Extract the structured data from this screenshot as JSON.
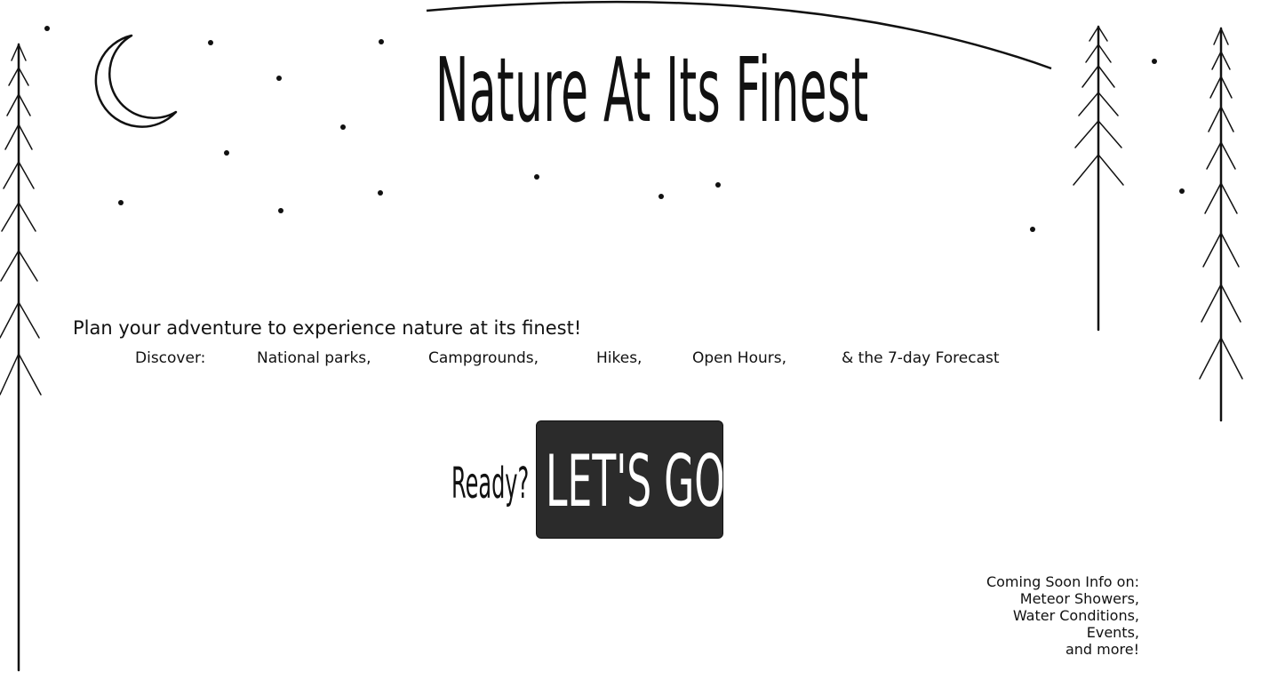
{
  "page": {
    "title": "Nature At Its Finest",
    "tagline": "Plan your adventure to experience nature at its finest!"
  },
  "discover": {
    "label": "Discover:",
    "items": [
      "National parks,",
      "Campgrounds,",
      "Hikes,",
      "Open Hours,",
      "& the 7-day Forecast"
    ]
  },
  "cta": {
    "prompt": "Ready?",
    "button_label": "LET'S GO!",
    "button_color": "#2b2b2b",
    "button_text_color": "#ffffff"
  },
  "coming_soon": {
    "heading": "Coming Soon Info on:",
    "items": [
      "Meteor Showers,",
      "Water Conditions,",
      "Events,",
      "and more!"
    ]
  },
  "decor": {
    "icons": [
      "crescent-moon-icon",
      "star-icon",
      "pine-tree-icon"
    ],
    "ink_color": "#111111"
  }
}
